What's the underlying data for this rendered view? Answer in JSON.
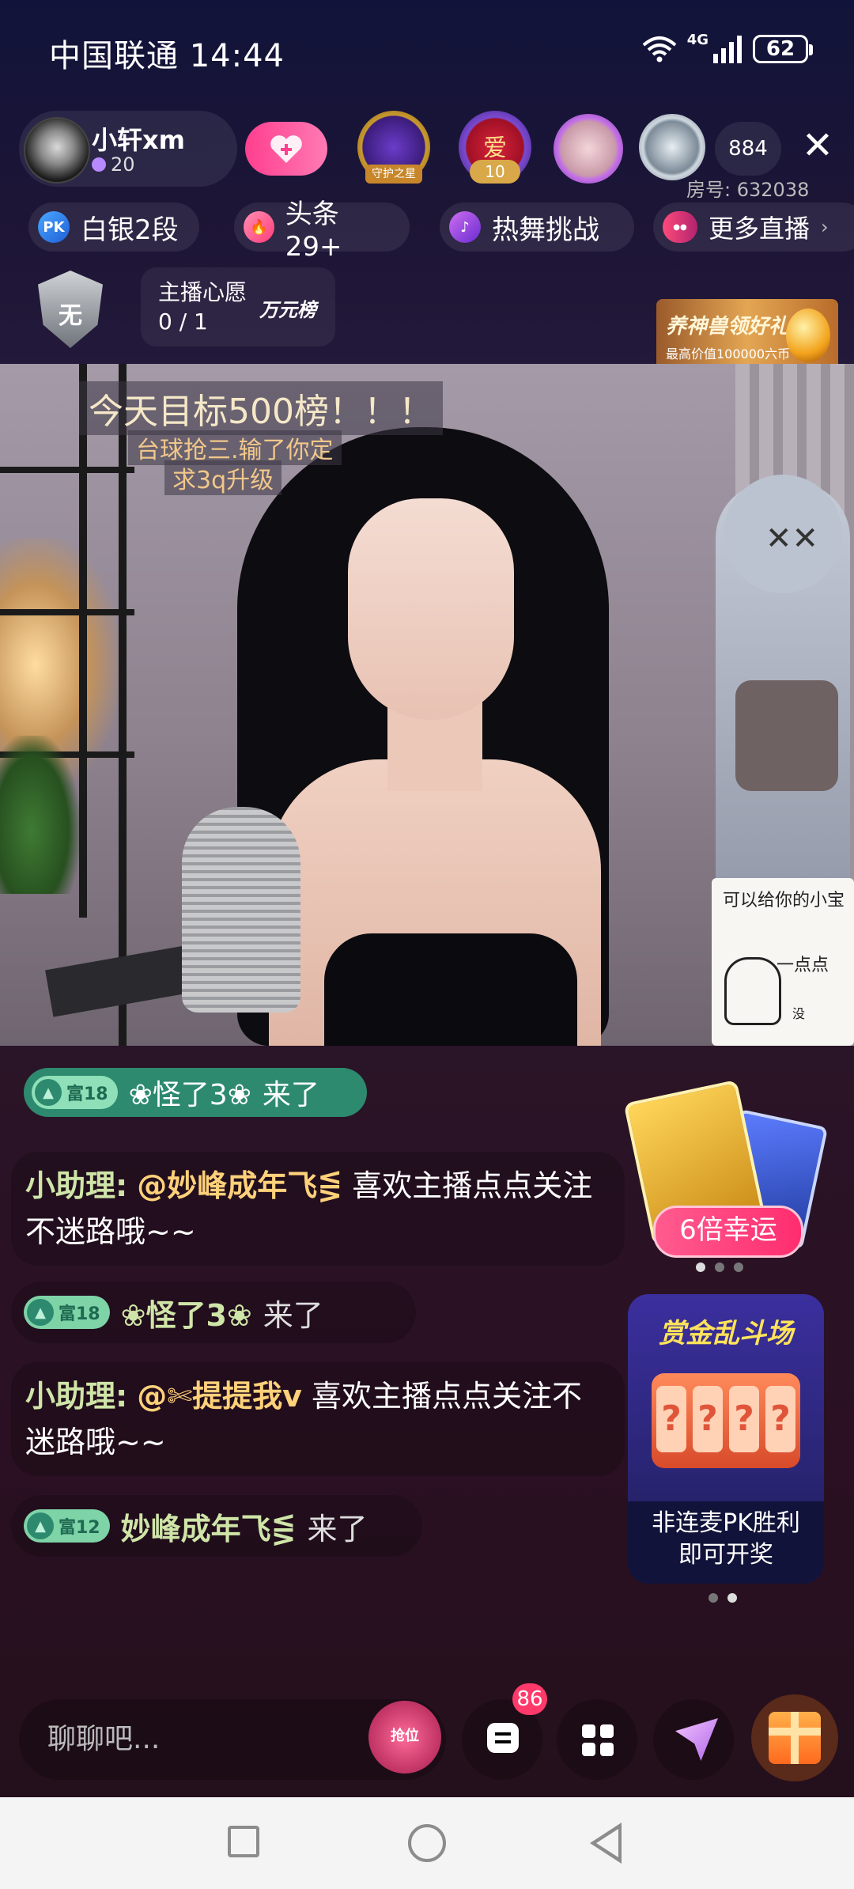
{
  "status_bar": {
    "carrier": "中国联通",
    "time": "14:44",
    "network": "4G",
    "battery": "62"
  },
  "header": {
    "host_name": "小轩xm",
    "host_level": "20",
    "guard_label": "守护之星",
    "love_char": "爱",
    "love_level": "10",
    "viewer_count": "884",
    "close": "✕",
    "room_label": "房号:",
    "room_number": "632038"
  },
  "tags": [
    {
      "icon": "PK",
      "label": "白银2段"
    },
    {
      "icon": "🔥",
      "label": "头条29+"
    },
    {
      "icon": "♪",
      "label": "热舞挑战"
    },
    {
      "icon": "●●",
      "label": "更多直播",
      "chevron": "›"
    }
  ],
  "wish": {
    "shield_char": "无",
    "title": "主播心愿",
    "value": "0 / 1",
    "rank": "万元榜"
  },
  "gift_banner": {
    "title": "养神兽领好礼",
    "subtitle": "最高价值100000六币"
  },
  "video_overlay": {
    "line1": "今天目标500榜！！！",
    "line2": "台球抢三.输了你定",
    "line3": "求3q升级",
    "sticker_top": "可以给你的小宝",
    "sticker_mid": "一点点",
    "sticker_bottom": "没"
  },
  "chat": {
    "banner": {
      "rich_label": "富18",
      "name": "❀怪了3❀",
      "action": "来了"
    },
    "messages": [
      {
        "who": "小助理:",
        "at": "@妙峰成年飞⋚",
        "text": "喜欢主播点点关注不迷路哦~~"
      },
      {
        "rich_label": "富18",
        "name": "❀怪了3❀",
        "action": "来了"
      },
      {
        "who": "小助理:",
        "at": "@✄提提我v",
        "text": "喜欢主播点点关注不迷路哦~~"
      },
      {
        "rich_label": "富12",
        "name": "妙峰成年飞⋚",
        "action": "来了"
      }
    ]
  },
  "promos": {
    "luck_button": "6倍幸运",
    "arena_title": "赏金乱斗场",
    "arena_slots": [
      "?",
      "?",
      "?",
      "?"
    ],
    "arena_line1": "非连麦PK胜利",
    "arena_line2": "即可开奖"
  },
  "bottom_bar": {
    "input_placeholder": "聊聊吧...",
    "grab_label": "抢位",
    "chat_badge": "86"
  },
  "colors": {
    "accent_pink": "#ff3f8f",
    "join_green": "#2d8a6e",
    "name_green": "#cfe5a8",
    "at_gold": "#ffd17a"
  }
}
